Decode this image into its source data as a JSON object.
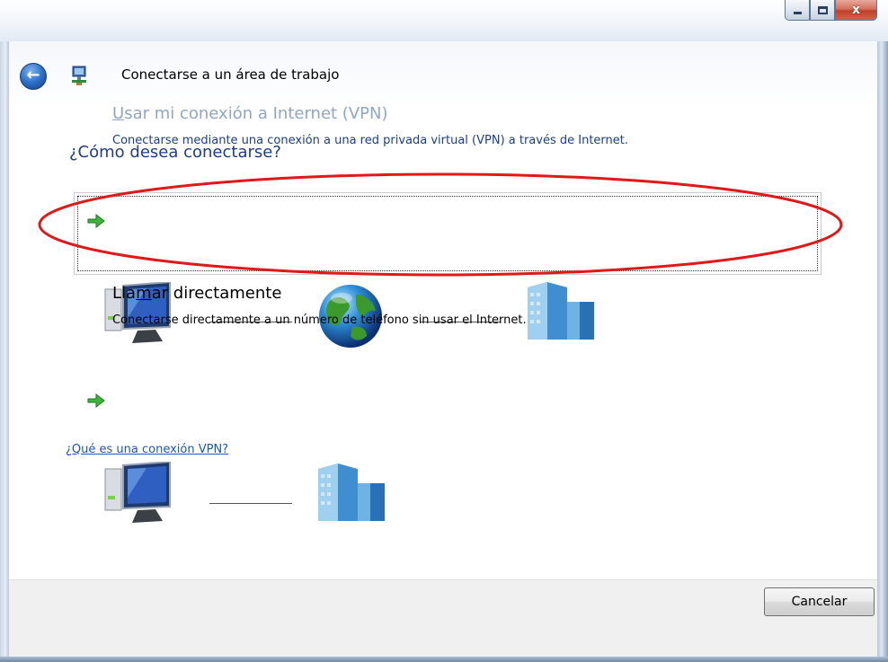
{
  "window": {
    "title": "Conectarse a un área de trabajo",
    "close_glyph": "x"
  },
  "content": {
    "question": "¿Cómo desea conectarse?",
    "options": [
      {
        "title_prefix": "",
        "title_underlined": "U",
        "title_rest": "sar mi conexión a Internet (VPN)",
        "description": "Conectarse mediante una conexión a una red privada virtual (VPN) a través de Internet.",
        "icons": [
          "computer-icon",
          "globe-icon",
          "office-building-icon"
        ]
      },
      {
        "title_prefix": "Lla",
        "title_underlined": "m",
        "title_rest": "ar directamente",
        "description": "Conectarse directamente a un número de teléfono sin usar el Internet.",
        "icons": [
          "computer-icon",
          "office-building-icon"
        ]
      }
    ],
    "help_link": "¿Qué es una conexión VPN?"
  },
  "footer": {
    "cancel_label": "Cancelar"
  },
  "colors": {
    "question": "#1f3c88",
    "vpn_title_hover": "#8fa6c7",
    "vpn_desc": "#1a3d8f",
    "link": "#1c55c4",
    "annotation_ellipse": "#e01818"
  }
}
